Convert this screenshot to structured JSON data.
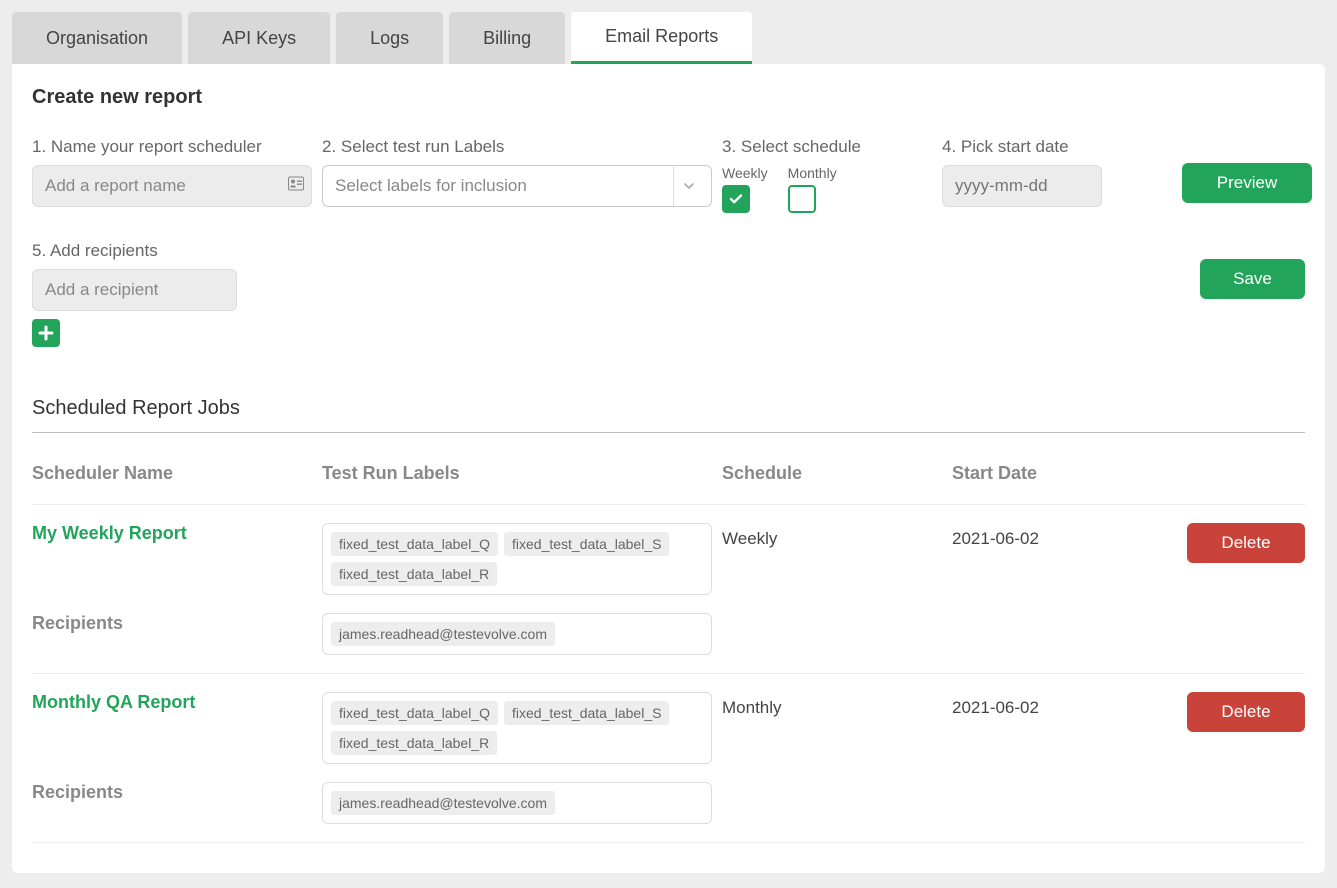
{
  "tabs": [
    {
      "label": "Organisation"
    },
    {
      "label": "API Keys"
    },
    {
      "label": "Logs"
    },
    {
      "label": "Billing"
    },
    {
      "label": "Email Reports",
      "active": true
    }
  ],
  "headings": {
    "create": "Create new report",
    "jobs": "Scheduled Report Jobs"
  },
  "steps": {
    "name": "1. Name your report scheduler",
    "labels": "2. Select test run Labels",
    "schedule": "3. Select schedule",
    "start": "4. Pick start date",
    "recipients": "5. Add recipients"
  },
  "placeholders": {
    "name": "Add a report name",
    "labels": "Select labels for inclusion",
    "date": "yyyy-mm-dd",
    "recipient": "Add a recipient"
  },
  "schedule": {
    "weekly_label": "Weekly",
    "monthly_label": "Monthly",
    "weekly_checked": true,
    "monthly_checked": false
  },
  "buttons": {
    "preview": "Preview",
    "save": "Save",
    "delete": "Delete"
  },
  "jobs_table": {
    "cols": {
      "name": "Scheduler Name",
      "labels": "Test Run Labels",
      "schedule": "Schedule",
      "start": "Start Date"
    },
    "recipients_label": "Recipients"
  },
  "jobs": [
    {
      "name": "My Weekly Report",
      "labels": [
        "fixed_test_data_label_Q",
        "fixed_test_data_label_S",
        "fixed_test_data_label_R"
      ],
      "schedule": "Weekly",
      "start": "2021-06-02",
      "recipients": [
        "james.readhead@testevolve.com"
      ]
    },
    {
      "name": "Monthly QA Report",
      "labels": [
        "fixed_test_data_label_Q",
        "fixed_test_data_label_S",
        "fixed_test_data_label_R"
      ],
      "schedule": "Monthly",
      "start": "2021-06-02",
      "recipients": [
        "james.readhead@testevolve.com"
      ]
    }
  ]
}
